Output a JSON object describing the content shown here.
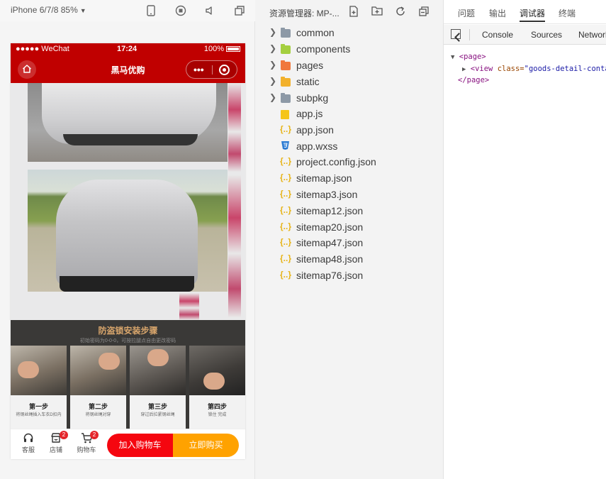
{
  "simulator": {
    "device_label": "iPhone 6/7/8 85%",
    "status_bar": {
      "carrier": "●●●●● WeChat",
      "time": "17:24",
      "battery": "100%"
    },
    "navbar": {
      "title": "黑马优购"
    },
    "steps": {
      "title": "防盗锁安装步骤",
      "subtitle": "初始密码为0-0-0，可按拉腿点自由更改密码",
      "items": [
        {
          "name": "第一步",
          "desc": "将钢丝绳插入车衣D扣内"
        },
        {
          "name": "第二步",
          "desc": "将钢丝绳对穿"
        },
        {
          "name": "第三步",
          "desc": "穿过后拉紧钢丝绳"
        },
        {
          "name": "第四步",
          "desc": "锁住 完成"
        }
      ]
    },
    "bottom_bar": {
      "service_label": "客服",
      "shop_label": "店铺",
      "shop_badge": "2",
      "cart_label": "购物车",
      "cart_badge": "2",
      "add_cart_label": "加入购物车",
      "buy_now_label": "立即购买"
    },
    "colors": {
      "brand_red": "#c00000",
      "cart_red": "#f5060f",
      "buy_orange": "#ffa200"
    }
  },
  "explorer": {
    "title": "资源管理器: MP-...",
    "items": [
      {
        "name": "common",
        "kind": "folder",
        "color": "#8d99a6"
      },
      {
        "name": "components",
        "kind": "folder",
        "color": "#a4cf3f"
      },
      {
        "name": "pages",
        "kind": "folder",
        "color": "#f0783c"
      },
      {
        "name": "static",
        "kind": "folder",
        "color": "#f2b12c"
      },
      {
        "name": "subpkg",
        "kind": "folder",
        "color": "#8d99a6"
      },
      {
        "name": "app.js",
        "kind": "js"
      },
      {
        "name": "app.json",
        "kind": "json"
      },
      {
        "name": "app.wxss",
        "kind": "css"
      },
      {
        "name": "project.config.json",
        "kind": "json"
      },
      {
        "name": "sitemap.json",
        "kind": "json"
      },
      {
        "name": "sitemap3.json",
        "kind": "json"
      },
      {
        "name": "sitemap12.json",
        "kind": "json"
      },
      {
        "name": "sitemap20.json",
        "kind": "json"
      },
      {
        "name": "sitemap47.json",
        "kind": "json"
      },
      {
        "name": "sitemap48.json",
        "kind": "json"
      },
      {
        "name": "sitemap76.json",
        "kind": "json"
      }
    ]
  },
  "devtools": {
    "tabs": [
      "问题",
      "输出",
      "调试器",
      "终端"
    ],
    "active_tab": "调试器",
    "subtabs": [
      "Console",
      "Sources",
      "Network"
    ],
    "elements": {
      "page_open": "<page>",
      "view_tag": "<view",
      "view_attr": "class=",
      "view_value": "\"goods-detail-container\"",
      "page_close": "</page>"
    }
  }
}
